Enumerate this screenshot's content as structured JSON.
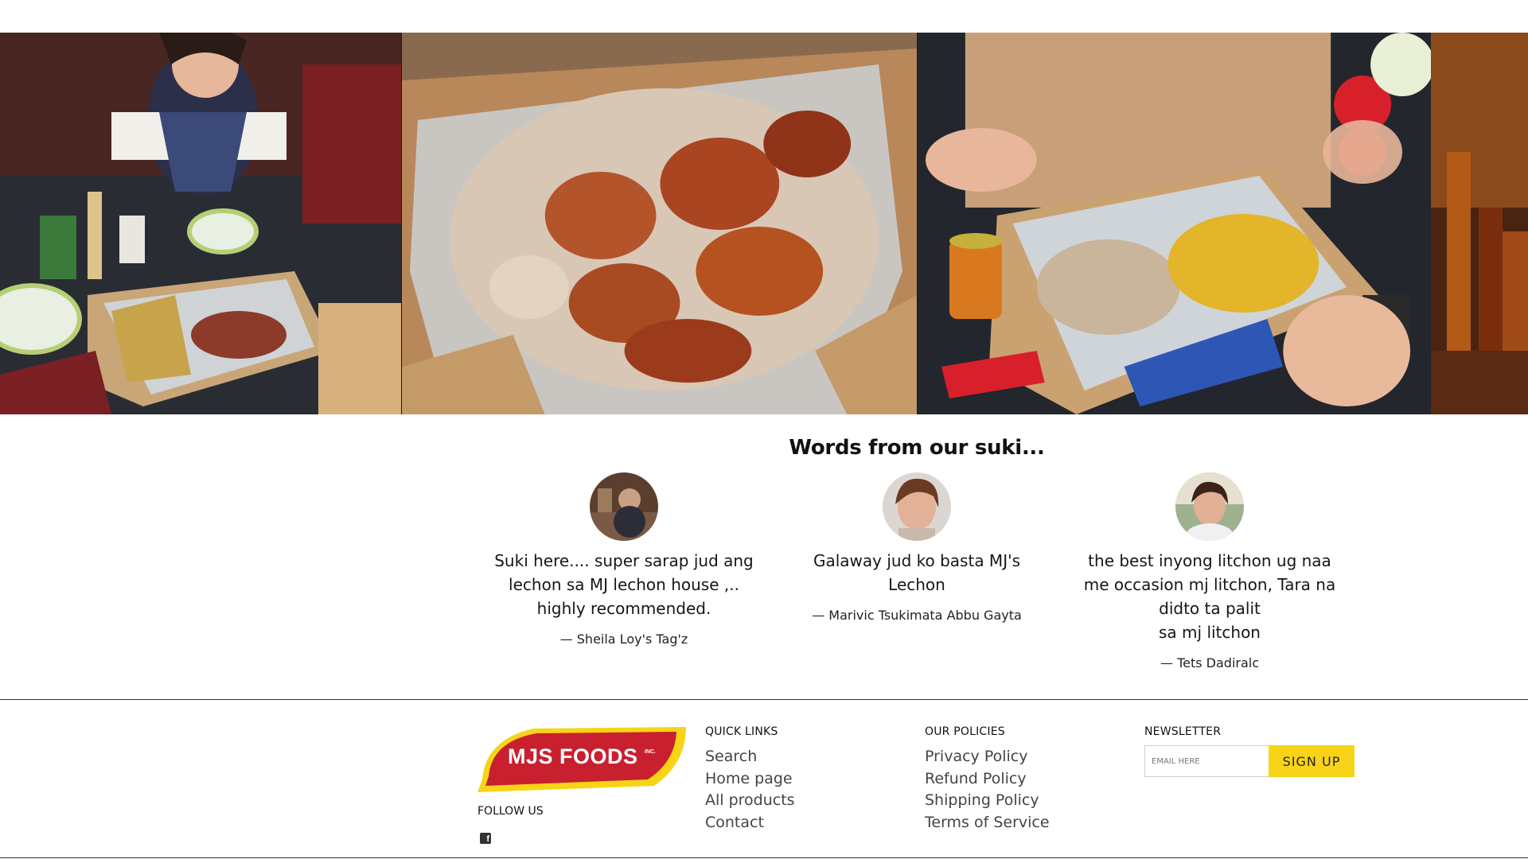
{
  "gallery": {
    "photos": [
      {
        "subject": "group-sharing-lechon-box"
      },
      {
        "subject": "lechon-closeup"
      },
      {
        "subject": "hands-with-forks-over-lechon-and-noodles"
      },
      {
        "subject": "bottles-on-shelf"
      }
    ]
  },
  "testimonials": {
    "title": "Words from our suki...",
    "items": [
      {
        "quote_lines": [
          "Suki here.... super sarap jud ang",
          "lechon sa MJ lechon house ,..",
          "highly recommended."
        ],
        "author": "— Sheila Loy's Tag'z"
      },
      {
        "quote_lines": [
          "Galaway jud ko basta MJ's",
          "Lechon"
        ],
        "author": "— Marivic Tsukimata Abbu Gayta"
      },
      {
        "quote_lines": [
          "the best inyong litchon ug naa",
          "me occasion mj litchon, Tara na",
          "didto ta palit",
          "sa mj litchon"
        ],
        "author": "— Tets Dadiralc"
      }
    ]
  },
  "footer": {
    "logo": {
      "text": "MJS FOODS",
      "suffix": "INC."
    },
    "follow_label": "FOLLOW US",
    "social_icon": "facebook-icon",
    "quick_links": {
      "heading": "QUICK LINKS",
      "items": [
        "Search",
        "Home page",
        "All products",
        "Contact"
      ]
    },
    "policies": {
      "heading": "OUR POLICIES",
      "items": [
        "Privacy Policy",
        "Refund Policy",
        "Shipping Policy",
        "Terms of Service"
      ]
    },
    "newsletter": {
      "heading": "NEWSLETTER",
      "placeholder": "EMAIL HERE",
      "button_label": "SIGN UP"
    }
  },
  "colors": {
    "brand_red": "#c8202f",
    "brand_yellow": "#f7d417",
    "signup_yellow": "#f7d417"
  }
}
